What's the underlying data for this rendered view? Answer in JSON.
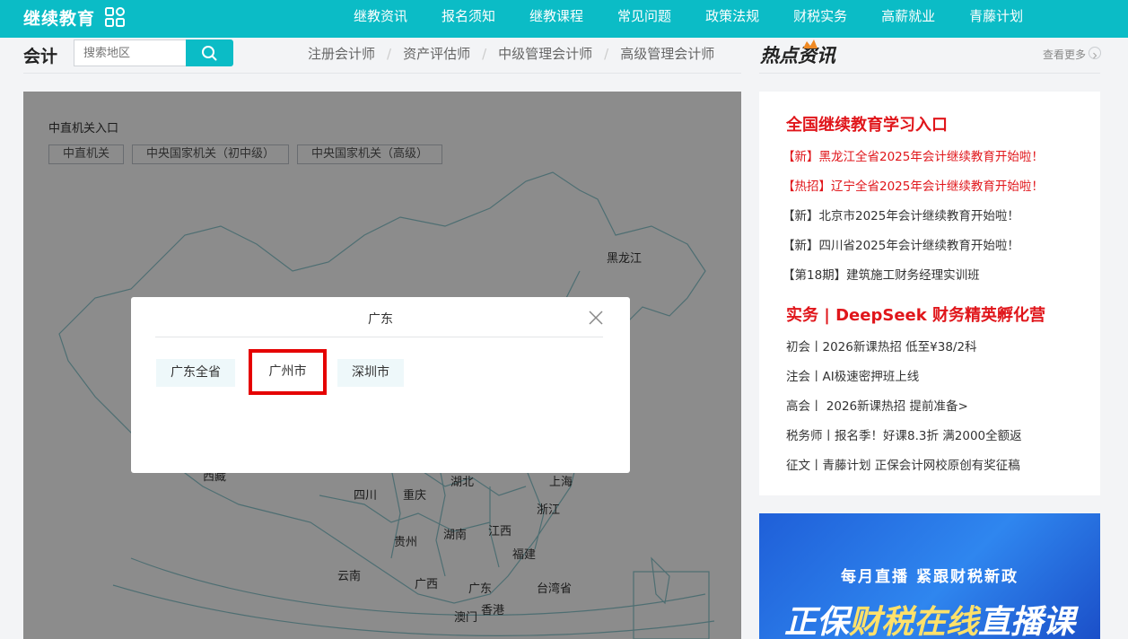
{
  "header": {
    "logo": "继续教育",
    "nav": [
      "继教资讯",
      "报名须知",
      "继教课程",
      "常见问题",
      "政策法规",
      "财税实务",
      "高薪就业",
      "青藤计划"
    ]
  },
  "subbar": {
    "title": "会计",
    "search_placeholder": "搜索地区",
    "cert_links": [
      "注册会计师",
      "资产评估师",
      "中级管理会计师",
      "高级管理会计师"
    ],
    "separator": "/"
  },
  "map": {
    "org_title": "中直机关入口",
    "org_buttons": [
      "中直机关",
      "中央国家机关（初中级）",
      "中央国家机关（高级）"
    ],
    "provinces": [
      "黑龙江",
      "西藏",
      "四川",
      "重庆",
      "湖北",
      "上海",
      "浙江",
      "贵州",
      "湖南",
      "江西",
      "福建",
      "云南",
      "广西",
      "广东",
      "台湾省",
      "澳门",
      "香港"
    ]
  },
  "modal": {
    "title": "广东",
    "cities": [
      "广东全省",
      "广州市",
      "深圳市"
    ],
    "highlighted_city": "广州市"
  },
  "sidebar": {
    "hot_title": "热点资讯",
    "more": "查看更多",
    "section1_title": "全国继续教育学习入口",
    "section1_items": [
      {
        "text": "【新】黑龙江全省2025年会计继续教育开始啦！",
        "color": "#e0161b"
      },
      {
        "text": "【热招】辽宁全省2025年会计继续教育开始啦！",
        "color": "#e0161b"
      },
      {
        "text": "【新】北京市2025年会计继续教育开始啦！",
        "color": "#333333"
      },
      {
        "text": "【新】四川省2025年会计继续教育开始啦！",
        "color": "#333333"
      },
      {
        "text": "【第18期】建筑施工财务经理实训班",
        "color": "#333333"
      }
    ],
    "section2_title": "实务 | DeepSeek 财务精英孵化营",
    "section2_items": [
      "初会丨2026新课热招 低至¥38/2科",
      "注会丨AI极速密押班上线",
      "高会丨 2026新课热招 提前准备>",
      "税务师丨报名季！好课8.3折 满2000全额返",
      "征文丨青藤计划 正保会计网校原创有奖征稿"
    ]
  },
  "banner": {
    "sub": "每月直播  紧跟财税新政",
    "main_white": "正保",
    "main_yellow": "财税在线",
    "main_white2": "直播课"
  },
  "colors": {
    "accent": "#0bbcc6",
    "highlight": "#e50000",
    "news_red": "#e0161b"
  }
}
